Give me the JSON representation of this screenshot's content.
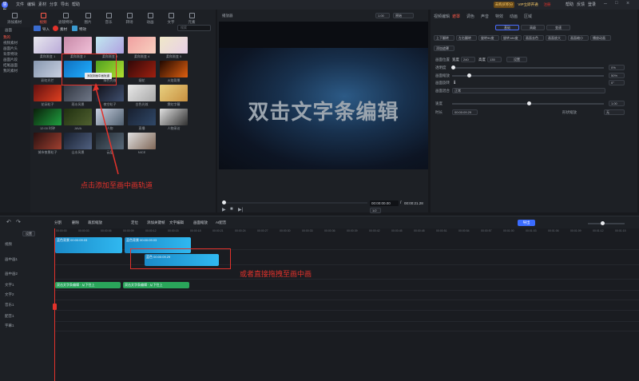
{
  "titlebar": {
    "app": "慧影",
    "menus": [
      "文件",
      "编辑",
      "素材",
      "分享",
      "导出",
      "帮助"
    ],
    "btn_material": "去购买积分",
    "btn_vip": "VIP立即开通",
    "btn_login": "注册",
    "right_items": [
      "帮助",
      "反馈",
      "登录"
    ]
  },
  "toolbar": {
    "items": [
      "添加素材",
      "视频",
      "滤镜特效",
      "图片",
      "音乐",
      "转场",
      "动画",
      "文字",
      "元素"
    ]
  },
  "media": {
    "search_placeholder": "搜索",
    "header": "画面",
    "tabs": [
      "导入",
      "素材",
      "特效"
    ],
    "categories": [
      "我的",
      "视频素材",
      "画面片头",
      "背景特效",
      "画面片段",
      "结尾画面",
      "我的素材"
    ],
    "items": [
      {
        "label": "柔和渐变 1",
        "c1": "#e8e8ee",
        "c2": "#b9a9d8"
      },
      {
        "label": "柔和渐变 2",
        "c1": "#c88aa8",
        "c2": "#f0c0d8"
      },
      {
        "label": "柔和渐变 3",
        "c1": "#c0e8f0",
        "c2": "#b0a0e0"
      },
      {
        "label": "柔和渐变 4",
        "c1": "#f0a0a0",
        "c2": "#f8d0c0"
      },
      {
        "label": "柔和渐变 5",
        "c1": "#f0e8c8",
        "c2": "#e8d0e8"
      },
      {
        "label": "彩虹光芒",
        "c1": "#8898b0",
        "c2": "#c8d0e0"
      },
      {
        "label": "",
        "c1": "#1070c0",
        "c2": "#20b0ff"
      },
      {
        "label": "绿色光效",
        "c1": "#50a020",
        "c2": "#b0e030"
      },
      {
        "label": "烟花",
        "c1": "#300808",
        "c2": "#a02010"
      },
      {
        "label": "火焰背景",
        "c1": "#200800",
        "c2": "#e06010"
      },
      {
        "label": "花朵粒子",
        "c1": "#601010",
        "c2": "#e04020"
      },
      {
        "label": "雨水风景",
        "c1": "#303540",
        "c2": "#707888"
      },
      {
        "label": "夜空粒子",
        "c1": "#101018",
        "c2": "#405070"
      },
      {
        "label": "白色光效",
        "c1": "#e8e8e8",
        "c2": "#a8a8a8"
      },
      {
        "label": "霓虹字幕",
        "c1": "#e8d080",
        "c2": "#c89040"
      },
      {
        "label": "12:00 时钟",
        "c1": "#0a200a",
        "c2": "#20a040"
      },
      {
        "label": "JAVA",
        "c1": "#203010",
        "c2": "#506030"
      },
      {
        "label": "人物",
        "c1": "#c8d0e0",
        "c2": "#506070"
      },
      {
        "label": "直播",
        "c1": "#182030",
        "c2": "#304868"
      },
      {
        "label": "人物采访",
        "c1": "#e0e0e0",
        "c2": "#303030"
      },
      {
        "label": "城市夜景粒子",
        "c1": "#281010",
        "c2": "#a04030"
      },
      {
        "label": "山水风景",
        "c1": "#182030",
        "c2": "#506080"
      },
      {
        "label": "云层",
        "c1": "#202830",
        "c2": "#586878"
      },
      {
        "label": "NICE",
        "c1": "#e0e0e0",
        "c2": "#806858"
      }
    ],
    "tooltip": "添加到画中画轨道"
  },
  "preview": {
    "title": "播放器",
    "ratio": "1.00",
    "mode": "原始",
    "overlay_text": "双击文字条编辑",
    "time_current": "00:00:00.00",
    "time_total": "00:00:21.28",
    "zoom": "1/2"
  },
  "props": {
    "tabs": [
      "视频编辑",
      "遮罩",
      "调色",
      "声音",
      "特效",
      "动画",
      "区域"
    ],
    "subtabs": [
      "基础",
      "高级",
      "变速"
    ],
    "buttons": [
      "上下翻转",
      "左右翻转",
      "旋转90度",
      "旋转180度",
      "画面去色",
      "画面放大",
      "画面缩小",
      "播放动画"
    ],
    "row2": "添加遮罩",
    "size_label": "画面位置",
    "w_label": "宽度",
    "w": "240",
    "h_label": "高度",
    "h": "135",
    "apply": "设置",
    "opacity_label": "透明度",
    "opacity": "0%",
    "scale_label": "画面缩放",
    "scale": "50%",
    "rotate_label": "画面旋转",
    "rotate": "0°",
    "blend_label": "画面混合",
    "blend": "正常",
    "speed_label": "速度",
    "speed": "1.00",
    "duration_label": "时长",
    "duration": "00:00:09.29",
    "shape_label": "形状缩放",
    "shape": "无"
  },
  "timeline": {
    "toolbar": [
      "分割",
      "删除",
      "裁剪缩放",
      "定位",
      "添加关键帧",
      "文字编辑",
      "画面缩放",
      "AI配音"
    ],
    "export": "导出",
    "tracks": [
      "视频",
      "画中画1",
      "画中画2",
      "文字1",
      "文字2",
      "音乐1",
      "配音1",
      "字幕1"
    ],
    "clip1_name": "蓝色背景",
    "clip1_time": "00:00:09.03",
    "clip2_name": "蓝色背景",
    "clip2_time": "00:00:09.03",
    "clip3_name": "蓝色",
    "clip3_time": "00:00:09.29",
    "text1": "双击文字条编辑 · 从下往上",
    "text2": "双击文字条编辑 · 从下往上",
    "ticks": [
      "00:00:00",
      "00:00:03",
      "00:00:06",
      "00:00:09",
      "00:00:12",
      "00:00:15",
      "00:00:18",
      "00:00:21",
      "00:00:24",
      "00:00:27",
      "00:00:30",
      "00:00:33",
      "00:00:36",
      "00:00:39",
      "00:00:42",
      "00:00:45",
      "00:00:48",
      "00:00:51",
      "00:00:54",
      "00:00:57",
      "00:01:00",
      "00:01:03",
      "00:01:06",
      "00:01:09",
      "00:01:12",
      "00:01:15"
    ]
  },
  "annotations": {
    "a1": "点击添加至画中画轨道",
    "a2": "或者直接拖拽至画中画"
  }
}
